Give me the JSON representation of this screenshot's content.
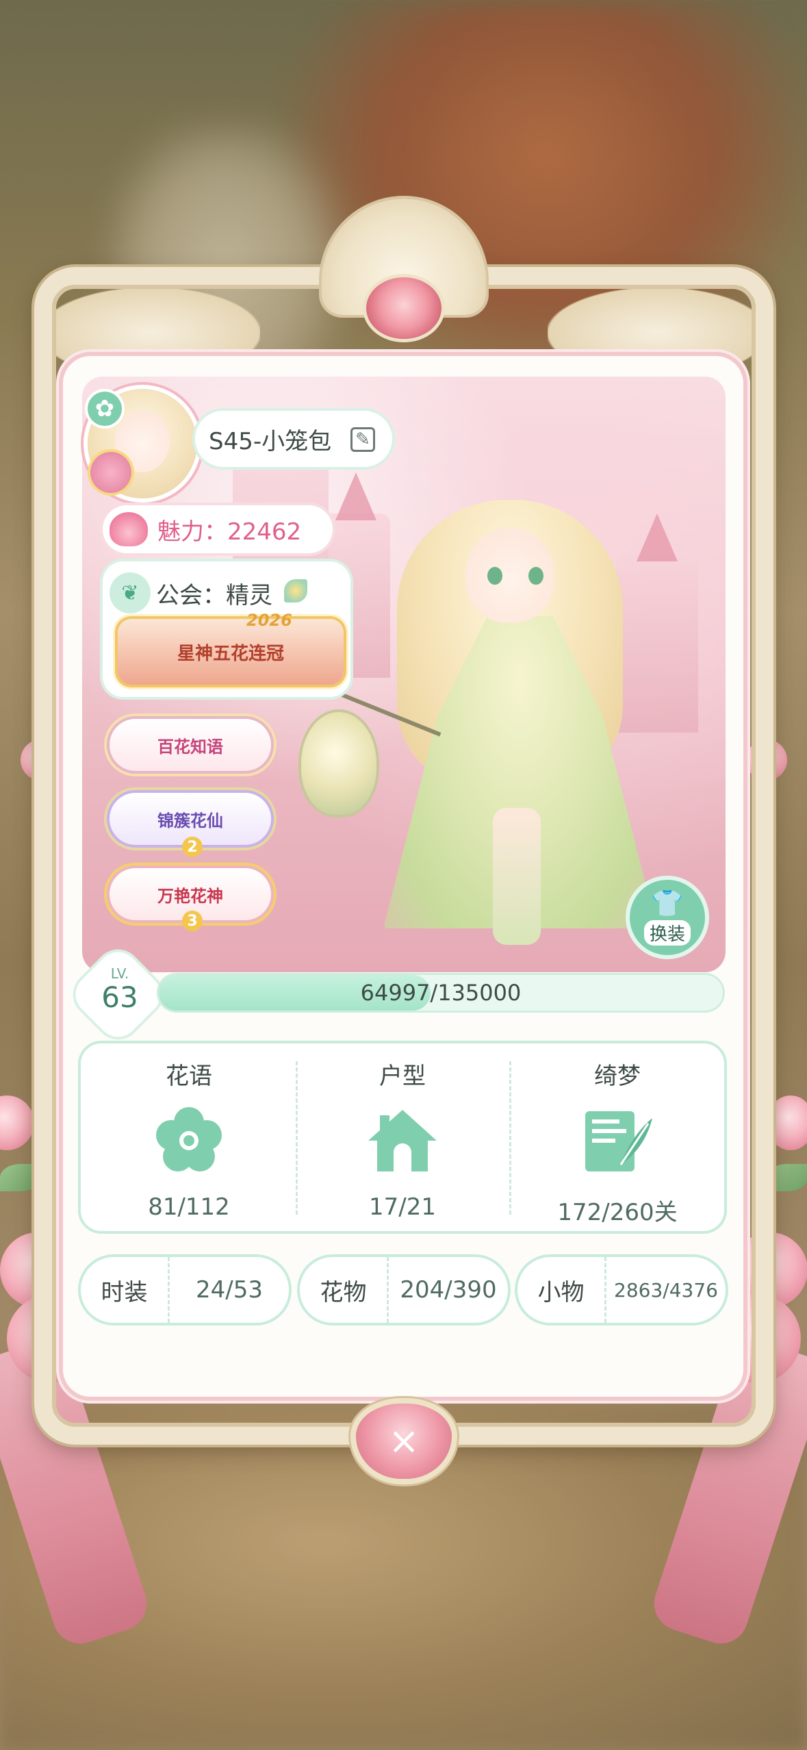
{
  "player": {
    "name": "S45-小笼包",
    "charm": "魅力：22462",
    "guild": "公会：精灵",
    "title_banner": "星神五花连冠",
    "title_year": "2026"
  },
  "badges": [
    {
      "label": "百花知语"
    },
    {
      "label": "锦簇花仙",
      "number": "2"
    },
    {
      "label": "万艳花神",
      "number": "3"
    }
  ],
  "outfit_button": {
    "label": "换装"
  },
  "level": {
    "lv_label": "LV.",
    "value": "63",
    "xp_text": "64997/135000",
    "xp_fraction": 0.4815
  },
  "stats": [
    {
      "title": "花语",
      "value": "81/112",
      "icon": "flower-icon"
    },
    {
      "title": "户型",
      "value": "17/21",
      "icon": "house-icon"
    },
    {
      "title": "绮梦",
      "value": "172/260关",
      "icon": "letter-quill-icon"
    }
  ],
  "collections": [
    {
      "label": "时装",
      "value": "24/53"
    },
    {
      "label": "花物",
      "value": "204/390"
    },
    {
      "label": "小物",
      "value": "2863/4376"
    }
  ],
  "colors": {
    "accent_mint": "#7fcfae",
    "accent_pink": "#e0608a",
    "frame_cream": "#efe5cf"
  }
}
